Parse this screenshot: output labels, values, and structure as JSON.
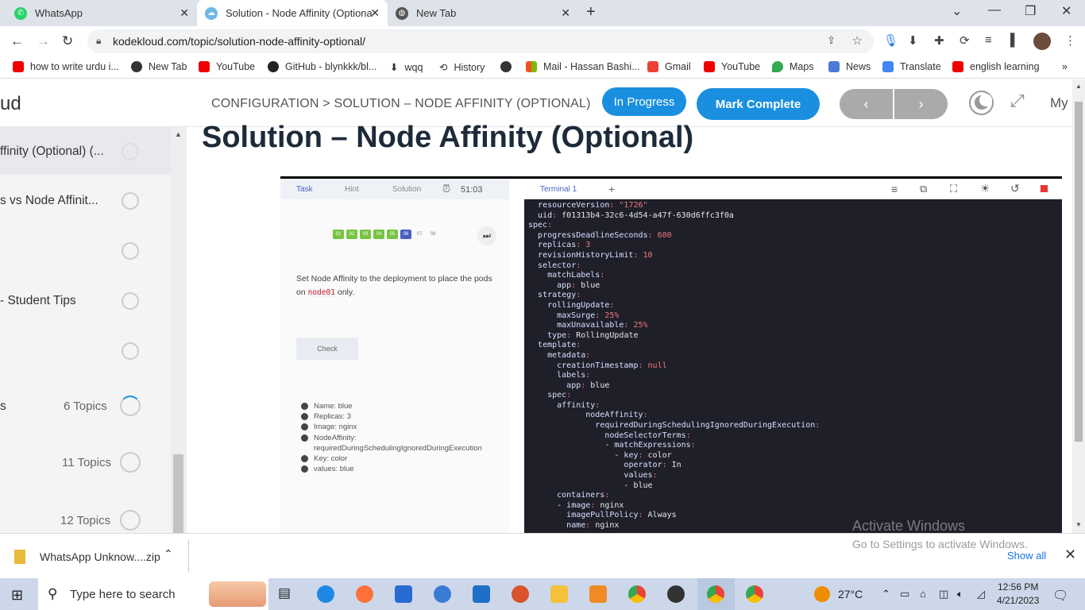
{
  "browser": {
    "tabs": [
      {
        "label": "WhatsApp",
        "icon": "whatsapp-icon"
      },
      {
        "label": "Solution - Node Affinity (Optiona",
        "icon": "kodekloud-icon"
      },
      {
        "label": "New Tab",
        "icon": "globe-icon"
      }
    ],
    "url": "kodekloud.com/topic/solution-node-affinity-optional/",
    "bookmarks": [
      "how to write urdu i...",
      "New Tab",
      "YouTube",
      "GitHub - blynkkk/bl...",
      "wqq",
      "History",
      "Mail - Hassan Bashi...",
      "Gmail",
      "YouTube",
      "Maps",
      "News",
      "Translate",
      "english learning"
    ]
  },
  "course": {
    "brand": "ud",
    "breadcrumb": "CONFIGURATION > SOLUTION – NODE AFFINITY (OPTIONAL)",
    "in_progress": "In Progress",
    "mark_complete": "Mark Complete",
    "prev": "‹",
    "next": "›",
    "my": "My",
    "title": "Solution – Node Affinity (Optional)",
    "sidebar": [
      {
        "label": "ffinity (Optional) (...",
        "count": ""
      },
      {
        "label": "s vs Node Affinit...",
        "count": ""
      },
      {
        "label": "",
        "count": ""
      },
      {
        "label": "- Student Tips",
        "count": ""
      },
      {
        "label": "",
        "count": ""
      },
      {
        "label": "s",
        "count": "6 Topics"
      },
      {
        "label": "",
        "count": "11 Topics"
      },
      {
        "label": "",
        "count": "12 Topics"
      }
    ]
  },
  "lab": {
    "tabs": [
      "Task",
      "Hint",
      "Solution"
    ],
    "timer": "51:03",
    "steps": [
      "01",
      "02",
      "03",
      "04",
      "05",
      "06",
      "07",
      "08"
    ],
    "task_text_1": "Set Node Affinity to the deployment to place the pods on",
    "task_code": "node01",
    "task_text_2": "only.",
    "check": "Check",
    "bullets": [
      "Name: blue",
      "Replicas: 3",
      "Image: nginx",
      "NodeAffinity:",
      "requiredDuringSchedulingIgnoredDuringExecution",
      "Key: color",
      "values: blue"
    ],
    "terminal_tab": "Terminal 1",
    "terminal_plus": "+"
  },
  "terminal_lines": [
    "  resourceVersion: \"1726\"",
    "  uid: f01313b4-32c6-4d54-a47f-630d6ffc3f0a",
    "spec:",
    "  progressDeadlineSeconds: 600",
    "  replicas: 3",
    "  revisionHistoryLimit: 10",
    "  selector:",
    "    matchLabels:",
    "      app: blue",
    "  strategy:",
    "    rollingUpdate:",
    "      maxSurge: 25%",
    "      maxUnavailable: 25%",
    "    type: RollingUpdate",
    "  template:",
    "    metadata:",
    "      creationTimestamp: null",
    "      labels:",
    "        app: blue",
    "    spec:",
    "      affinity:",
    "            nodeAffinity:",
    "              requiredDuringSchedulingIgnoredDuringExecution:",
    "                nodeSelectorTerms:",
    "                - matchExpressions:",
    "                  - key: color",
    "                    operator: In",
    "                    values:",
    "                    - blue",
    "      containers:",
    "      - image: nginx",
    "        imagePullPolicy: Always",
    "        name: nginx"
  ],
  "windows": {
    "activate_title": "Activate Windows",
    "activate_sub": "Go to Settings to activate Windows.",
    "download_file": "WhatsApp Unknow....zip",
    "show_all": "Show all",
    "search_placeholder": "Type here to search",
    "temp": "27°C",
    "time": "12:56 PM",
    "date": "4/21/2023"
  }
}
